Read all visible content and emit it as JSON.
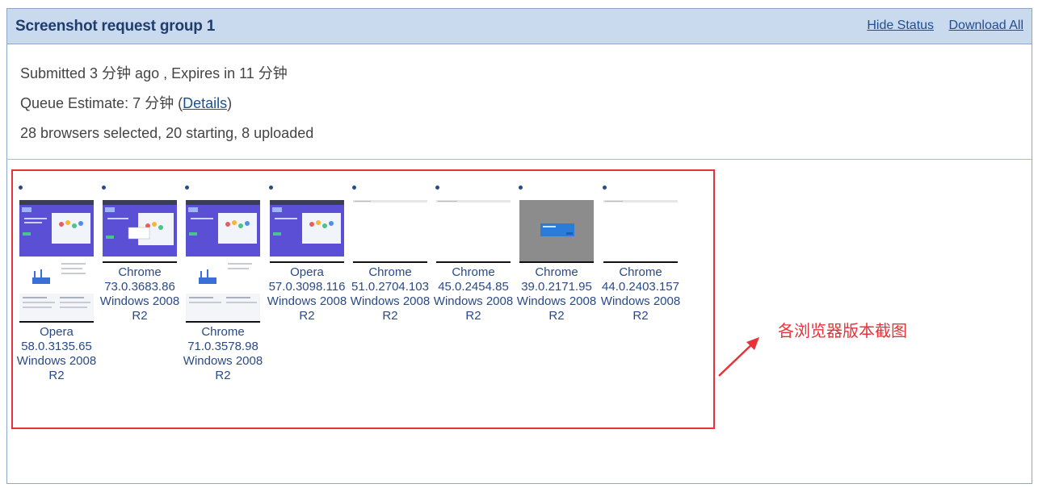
{
  "header": {
    "title": "Screenshot request group 1",
    "hide_status": "Hide Status",
    "download_all": "Download All"
  },
  "info": {
    "submitted": "Submitted 3 分钟 ago , Expires in 11 分钟",
    "queue_prefix": "Queue Estimate: 7 分钟 (",
    "queue_link": "Details",
    "queue_suffix": ")",
    "status": "28 browsers selected, 20 starting, 8 uploaded"
  },
  "screenshots": [
    {
      "browser": "Opera",
      "version": "58.0.3135.65",
      "os": "Windows 2008",
      "os2": "R2"
    },
    {
      "browser": "Chrome",
      "version": "73.0.3683.86",
      "os": "Windows 2008",
      "os2": "R2"
    },
    {
      "browser": "Chrome",
      "version": "71.0.3578.98",
      "os": "Windows 2008",
      "os2": "R2"
    },
    {
      "browser": "Opera",
      "version": "57.0.3098.116",
      "os": "Windows 2008",
      "os2": "R2"
    },
    {
      "browser": "Chrome",
      "version": "51.0.2704.103",
      "os": "Windows 2008",
      "os2": "R2"
    },
    {
      "browser": "Chrome",
      "version": "45.0.2454.85",
      "os": "Windows 2008",
      "os2": "R2"
    },
    {
      "browser": "Chrome",
      "version": "39.0.2171.95",
      "os": "Windows 2008",
      "os2": "R2"
    },
    {
      "browser": "Chrome",
      "version": "44.0.2403.157",
      "os": "Windows 2008",
      "os2": "R2"
    }
  ],
  "annotation": "各浏览器版本截图",
  "colors": {
    "header_bg": "#c9d9ee",
    "link": "#1f4f8f",
    "label": "#2a4a86",
    "annotation": "#e8323a",
    "thumb_purple": "#5b4fd6"
  }
}
